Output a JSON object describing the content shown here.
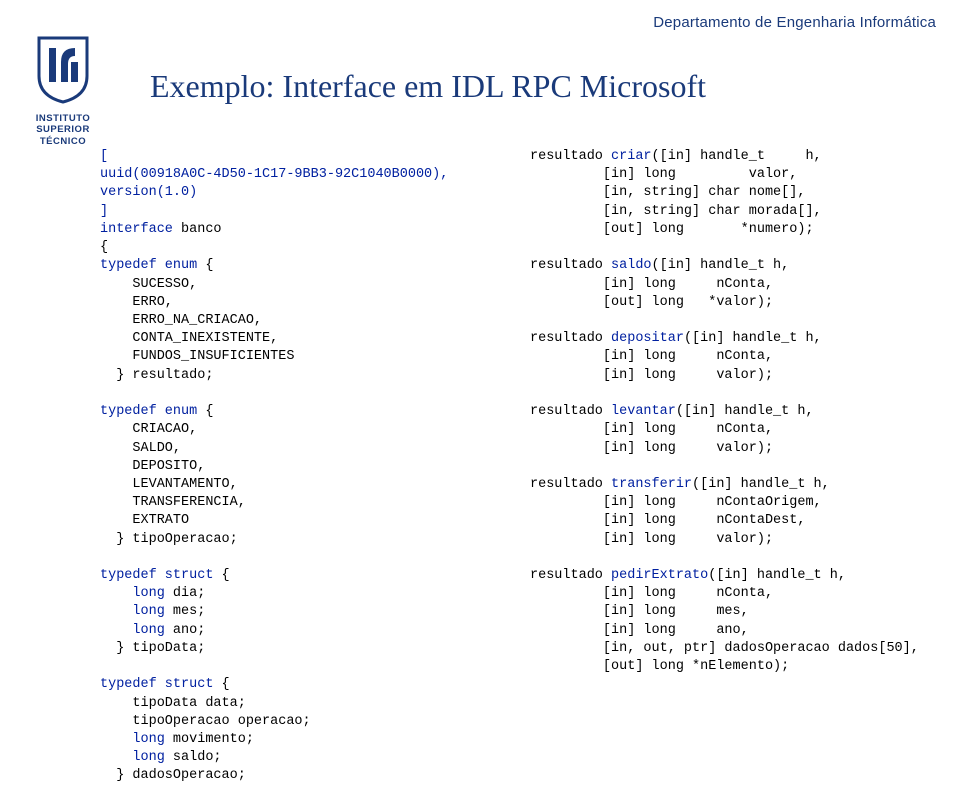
{
  "header": "Departamento de Engenharia Informática",
  "logo": {
    "line1": "INSTITUTO",
    "line2": "SUPERIOR",
    "line3": "TÉCNICO"
  },
  "title": "Exemplo: Interface em IDL RPC Microsoft",
  "left": {
    "l1a": "[",
    "l1b": "uuid(00918A0C-4D50-1C17-9BB3-92C1040B0000),",
    "l1c": "version(1.0)",
    "l1d": "]",
    "l2a": "interface",
    "l2b": " banco",
    "l3a": "{",
    "l4a": "typedef enum",
    "l4b": " {",
    "l5": "    SUCESSO,",
    "l6": "    ERRO,",
    "l7": "    ERRO_NA_CRIACAO,",
    "l8": "    CONTA_INEXISTENTE,",
    "l9": "    FUNDOS_INSUFICIENTES",
    "l10": "  } resultado;",
    "l11a": "typedef enum",
    "l11b": " {",
    "l12": "    CRIACAO,",
    "l13": "    SALDO,",
    "l14": "    DEPOSITO,",
    "l15": "    LEVANTAMENTO,",
    "l16": "    TRANSFERENCIA,",
    "l17": "    EXTRATO",
    "l18": "  } tipoOperacao;",
    "l19a": "typedef struct",
    "l19b": " {",
    "l20a": "    long",
    "l20b": " dia;",
    "l21a": "    long",
    "l21b": " mes;",
    "l22a": "    long",
    "l22b": " ano;",
    "l23": "  } tipoData;",
    "l24a": "typedef struct",
    "l24b": " {",
    "l25": "    tipoData data;",
    "l26": "    tipoOperacao operacao;",
    "l27a": "    long",
    "l27b": " movimento;",
    "l28a": "    long",
    "l28b": " saldo;",
    "l29": "  } dadosOperacao;"
  },
  "right": {
    "r1a": "resultado ",
    "r1b": "criar",
    "r1c": "([in] handle_t     h,",
    "r2": "         [in] long         valor,",
    "r3": "         [in, string] char nome[],",
    "r4": "         [in, string] char morada[],",
    "r5": "         [out] long       *numero);",
    "r6a": "resultado ",
    "r6b": "saldo",
    "r6c": "([in] handle_t h,",
    "r7": "         [in] long     nConta,",
    "r8": "         [out] long   *valor);",
    "r9a": "resultado ",
    "r9b": "depositar",
    "r9c": "([in] handle_t h,",
    "r10": "         [in] long     nConta,",
    "r11": "         [in] long     valor);",
    "r12a": "resultado ",
    "r12b": "levantar",
    "r12c": "([in] handle_t h,",
    "r13": "         [in] long     nConta,",
    "r14": "         [in] long     valor);",
    "r15a": "resultado ",
    "r15b": "transferir",
    "r15c": "([in] handle_t h,",
    "r16": "         [in] long     nContaOrigem,",
    "r17": "         [in] long     nContaDest,",
    "r18": "         [in] long     valor);",
    "r19a": "resultado ",
    "r19b": "pedirExtrato",
    "r19c": "([in] handle_t h,",
    "r20": "         [in] long     nConta,",
    "r21": "         [in] long     mes,",
    "r22": "         [in] long     ano,",
    "r23": "         [in, out, ptr] dadosOperacao dados[50],",
    "r24": "         [out] long *nElemento);"
  }
}
